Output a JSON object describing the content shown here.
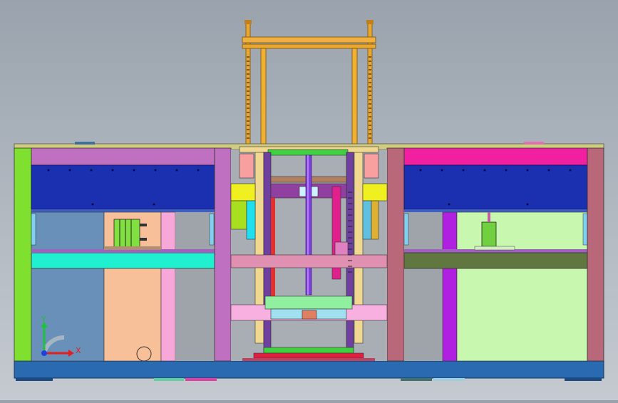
{
  "viewport": {
    "background_top": "#9aa3ad",
    "background_bottom": "#c5cad0"
  },
  "triad": {
    "x_label": "X",
    "y_label": "Y",
    "x_color": "#e02020",
    "y_color": "#20c040",
    "z_color": "#2040e0"
  },
  "parts": {
    "base_plate_color": "#2a6ab0",
    "top_frame_color": "#e8a830",
    "left_module_color": "#c070b8",
    "right_module_color": "#e02090",
    "press_frame_color": "#f0d890",
    "blue_beam_color": "#1a30b0",
    "cyan_plate_color": "#20f0d0",
    "green_plate_color": "#607840",
    "light_green_panel_color": "#c8f8b0",
    "steel_blue_panel_color": "#6890b8",
    "peach_panel_color": "#f8c098"
  }
}
